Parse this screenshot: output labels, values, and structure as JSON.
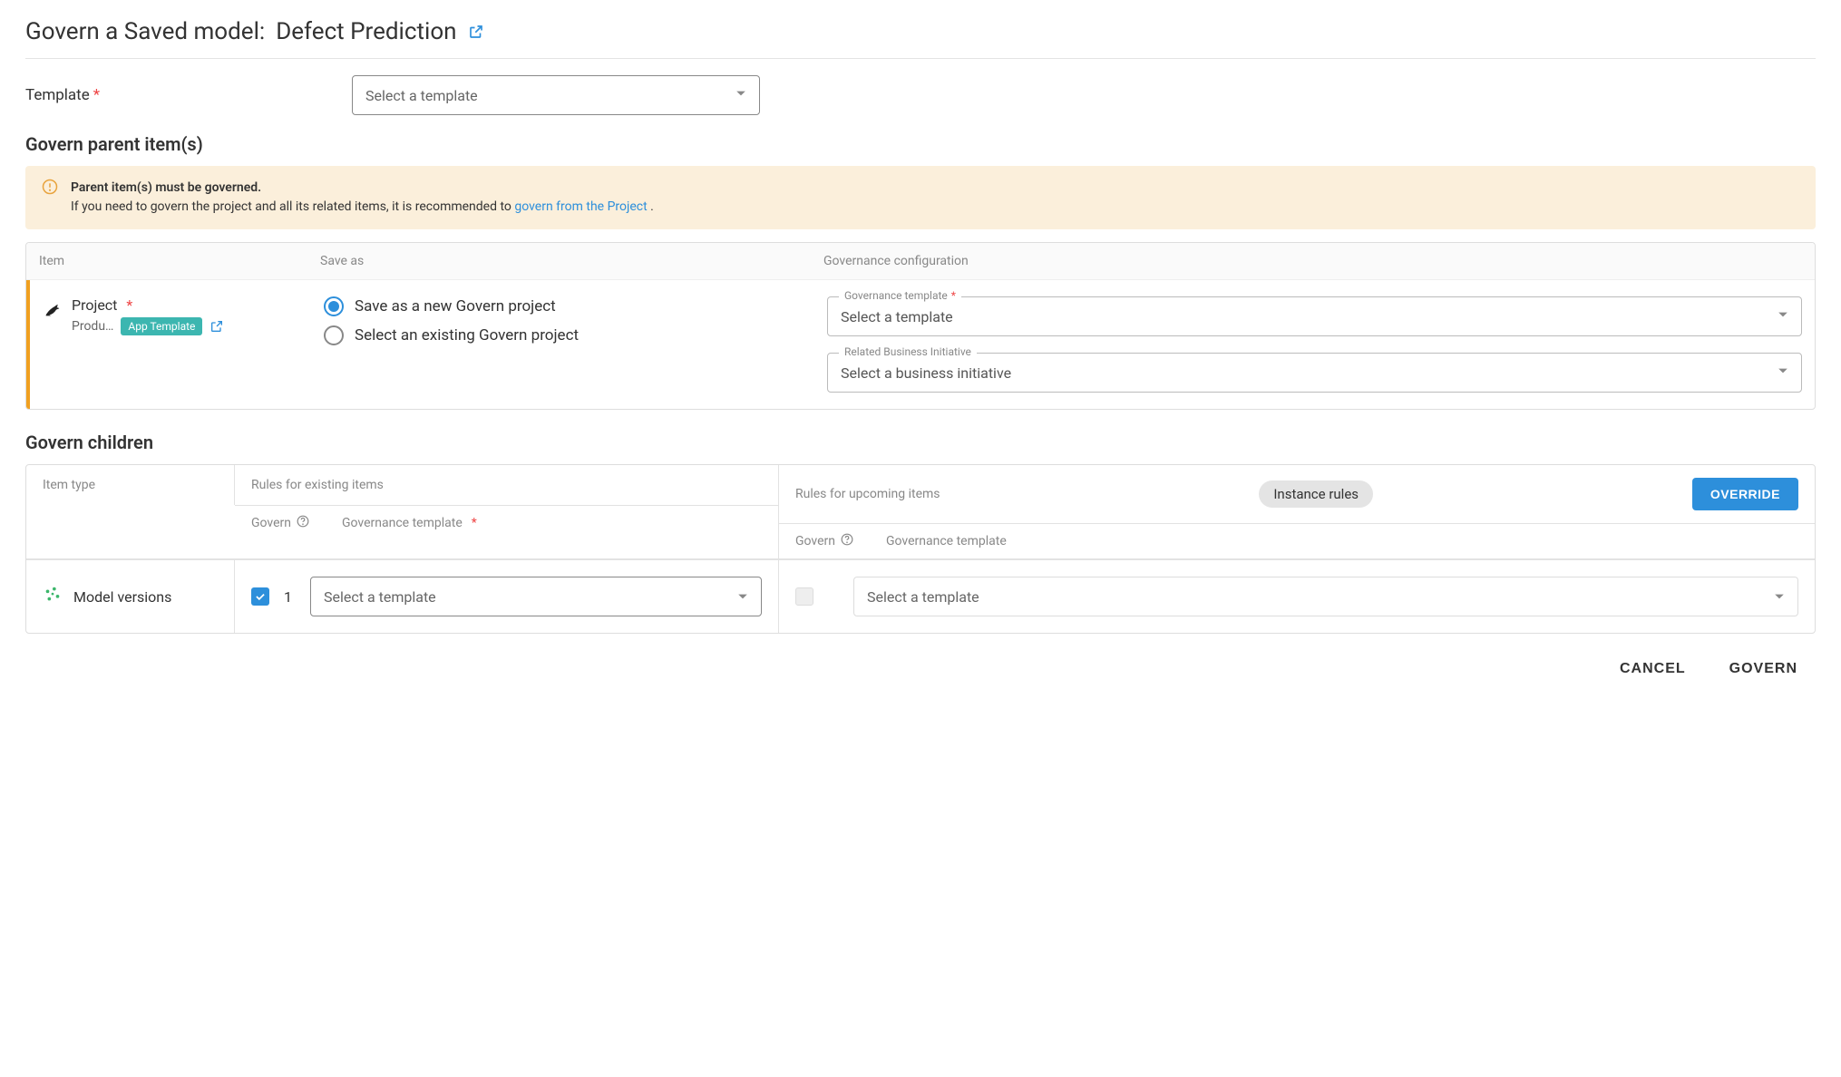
{
  "header": {
    "title_prefix": "Govern a Saved model:",
    "model_name": "Defect Prediction"
  },
  "template_field": {
    "label": "Template",
    "placeholder": "Select a template"
  },
  "parent_section": {
    "heading": "Govern parent item(s)",
    "warning": {
      "bold": "Parent item(s) must be governed.",
      "text": "If you need to govern the project and all its related items, it is recommended to ",
      "link_text": "govern from the Project",
      "after": " ."
    },
    "columns": {
      "item": "Item",
      "save_as": "Save as",
      "gov_config": "Governance configuration"
    },
    "row": {
      "item_label": "Project",
      "item_sub": "Produ…",
      "badge": "App Template",
      "radio_new": "Save as a new Govern project",
      "radio_existing": "Select an existing Govern project",
      "gov_template_label": "Governance template",
      "gov_template_placeholder": "Select a template",
      "biz_init_label": "Related Business Initiative",
      "biz_init_placeholder": "Select a business initiative"
    }
  },
  "children_section": {
    "heading": "Govern children",
    "columns": {
      "item_type": "Item type",
      "rules_existing": "Rules for existing items",
      "rules_upcoming": "Rules for upcoming items",
      "instance_rules": "Instance rules",
      "override": "OVERRIDE",
      "govern": "Govern",
      "gov_template": "Governance template"
    },
    "row": {
      "type_label": "Model versions",
      "count": "1",
      "template_placeholder": "Select a template"
    }
  },
  "footer": {
    "cancel": "CANCEL",
    "govern": "GOVERN"
  }
}
